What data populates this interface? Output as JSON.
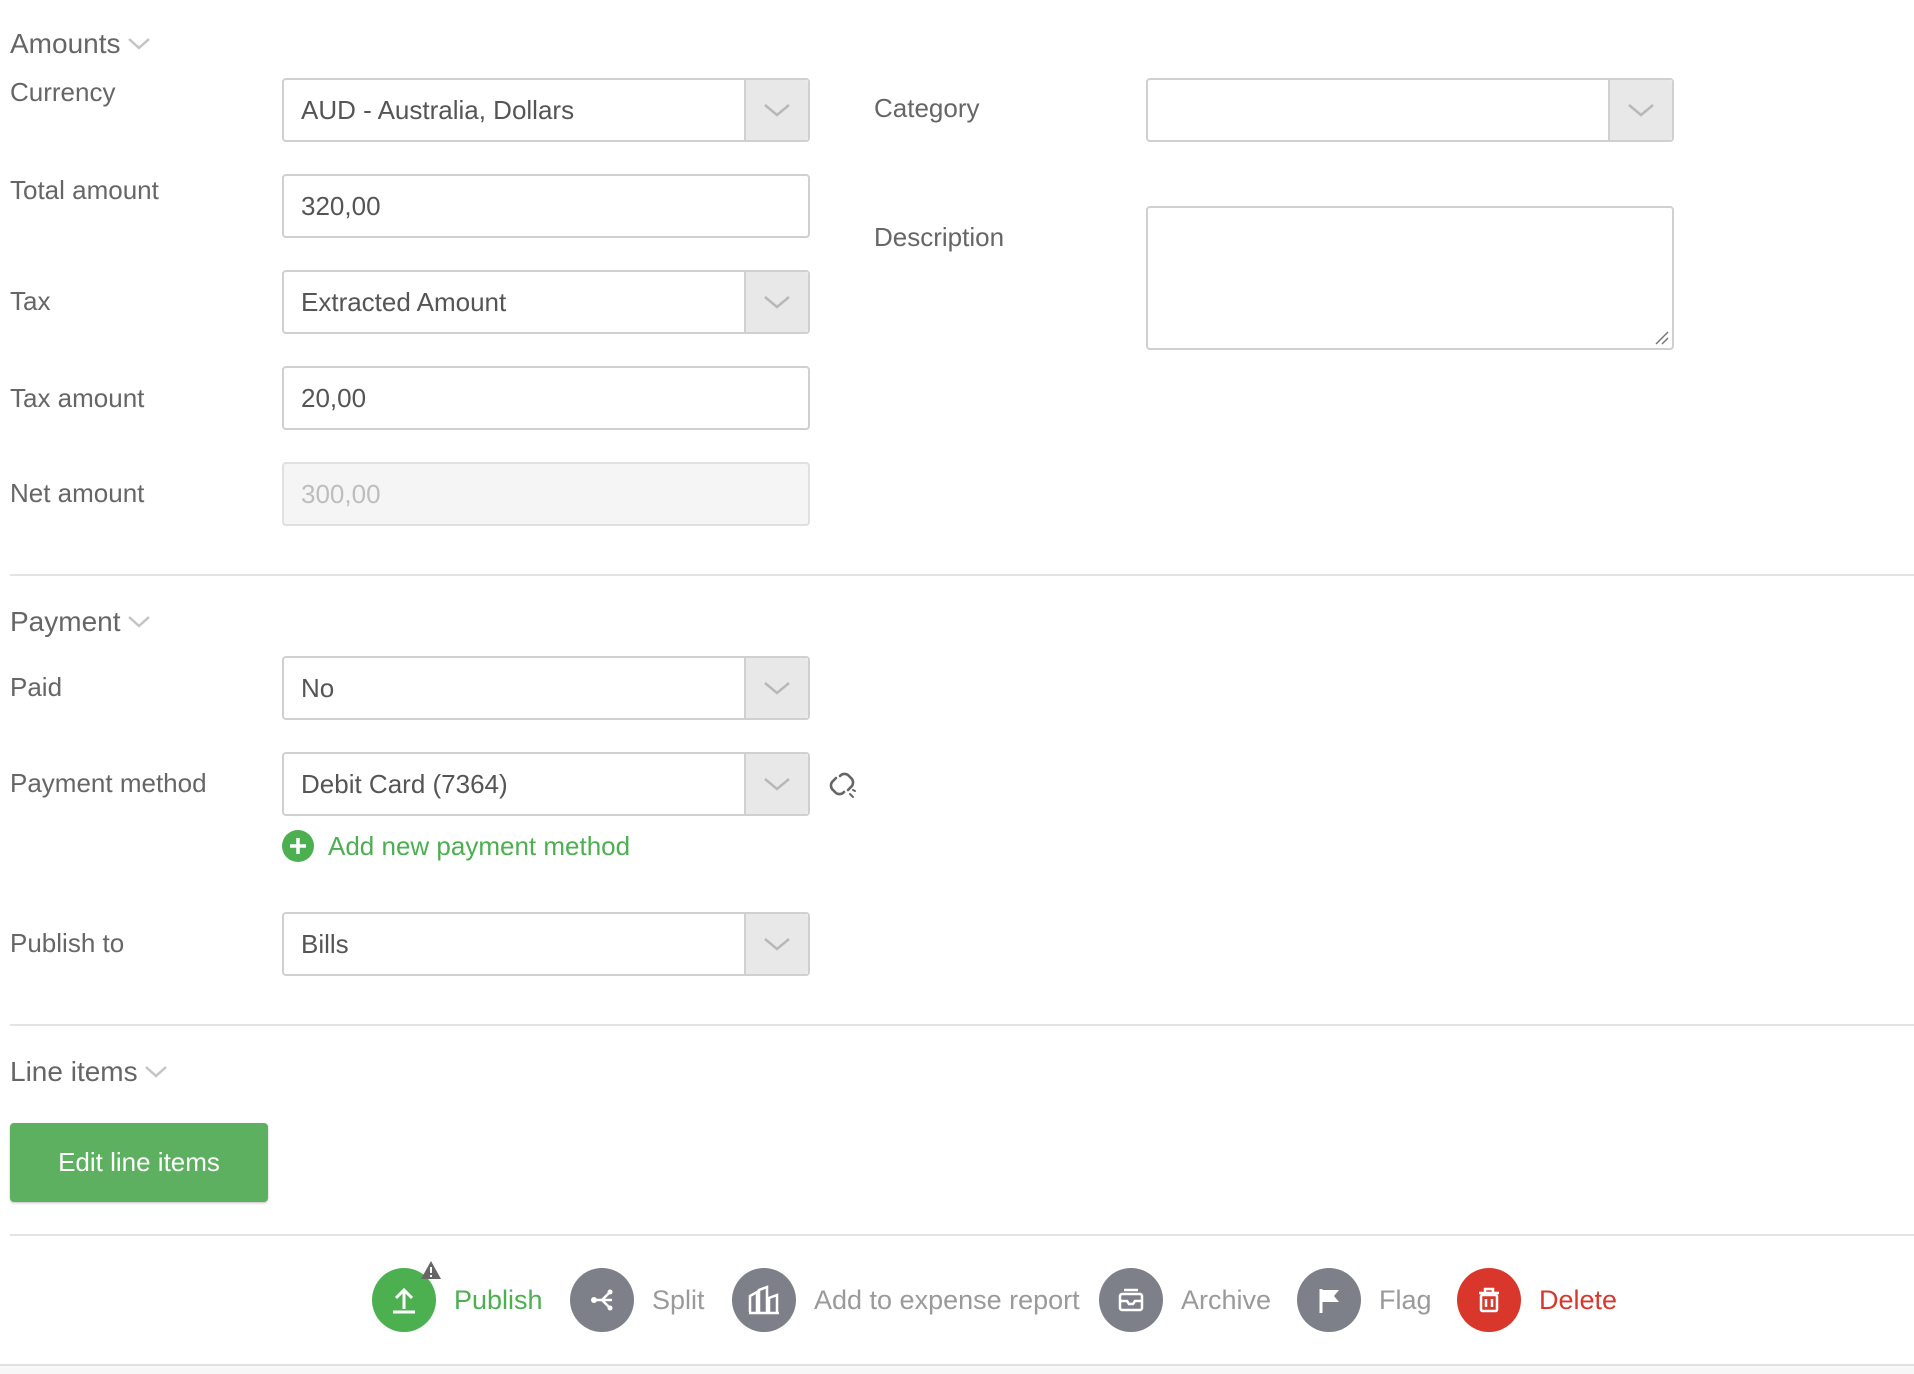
{
  "colors": {
    "accent_green": "#4caf50",
    "button_green": "#5cb05f",
    "action_grey": "#7d8088",
    "delete_red": "#d9372c"
  },
  "amounts": {
    "title": "Amounts",
    "currency": {
      "label": "Currency",
      "value": "AUD - Australia, Dollars"
    },
    "total_amount": {
      "label": "Total amount",
      "value": "320,00"
    },
    "tax": {
      "label": "Tax",
      "value": "Extracted Amount"
    },
    "tax_amount": {
      "label": "Tax amount",
      "value": "20,00"
    },
    "net_amount": {
      "label": "Net amount",
      "value": "300,00"
    },
    "category": {
      "label": "Category",
      "value": ""
    },
    "description": {
      "label": "Description",
      "value": ""
    }
  },
  "payment": {
    "title": "Payment",
    "paid": {
      "label": "Paid",
      "value": "No"
    },
    "payment_method": {
      "label": "Payment method",
      "value": "Debit Card (7364)"
    },
    "add_payment_method": "Add new payment method",
    "publish_to": {
      "label": "Publish to",
      "value": "Bills"
    }
  },
  "line_items": {
    "title": "Line items",
    "edit_button": "Edit line items"
  },
  "actions": [
    {
      "label": "Publish",
      "icon": "upload-icon"
    },
    {
      "label": "Split",
      "icon": "split-icon"
    },
    {
      "label": "Add to expense report",
      "icon": "expense-report-icon"
    },
    {
      "label": "Archive",
      "icon": "archive-icon"
    },
    {
      "label": "Flag",
      "icon": "flag-icon"
    },
    {
      "label": "Delete",
      "icon": "trash-icon"
    }
  ]
}
